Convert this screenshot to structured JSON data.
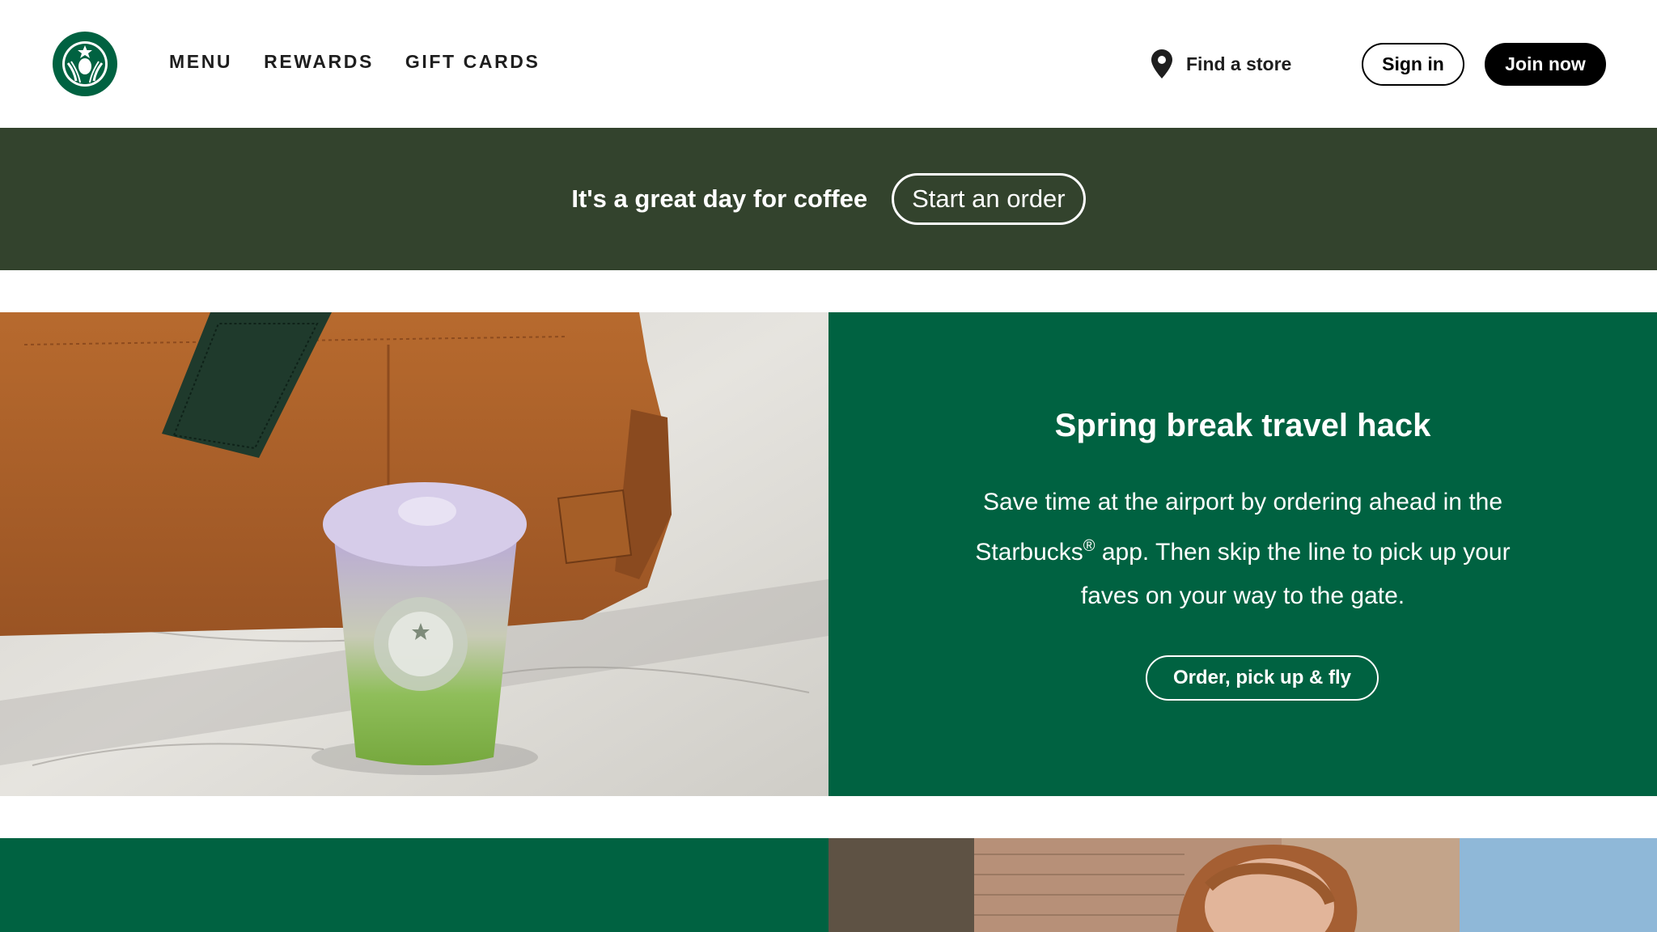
{
  "header": {
    "nav": [
      "MENU",
      "REWARDS",
      "GIFT CARDS"
    ],
    "find_store": "Find a store",
    "sign_in": "Sign in",
    "join_now": "Join now"
  },
  "banner": {
    "tagline": "It's a great day for coffee",
    "cta": "Start an order"
  },
  "promo": {
    "title": "Spring break travel hack",
    "body_part1": "Save time at the airport by ordering ahead in the Starbucks",
    "registered_mark": "®",
    "body_part2": " app. Then skip the line to pick up your faves on your way to the gate.",
    "cta": "Order, pick up & fly"
  },
  "icons": {
    "logo": "starbucks-siren-logo",
    "pin": "location-pin-icon"
  },
  "colors": {
    "banner_bg": "#33432d",
    "brand_green": "#006241",
    "header_bg": "#ffffff",
    "button_dark": "#000000"
  }
}
